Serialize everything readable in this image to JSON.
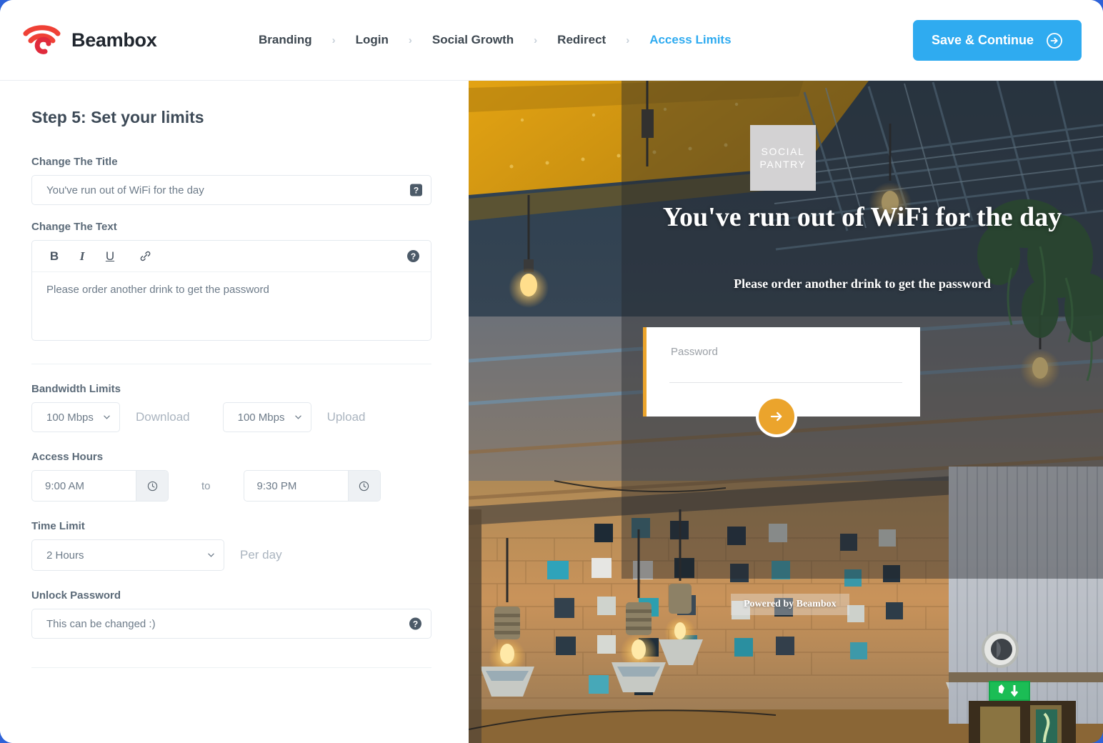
{
  "header": {
    "brand_name": "Beambox",
    "logo_icon": "beambox-wifi-logo",
    "breadcrumbs": [
      {
        "label": "Branding",
        "active": false
      },
      {
        "label": "Login",
        "active": false
      },
      {
        "label": "Social Growth",
        "active": false
      },
      {
        "label": "Redirect",
        "active": false
      },
      {
        "label": "Access Limits",
        "active": true
      }
    ],
    "separator": "›",
    "save_label": "Save & Continue",
    "save_icon": "arrow-right-circle-icon",
    "accent_color": "#2fabf0"
  },
  "form": {
    "step_title": "Step 5: Set your limits",
    "title_field": {
      "label": "Change The Title",
      "value": "You've run out of WiFi for the day",
      "help_icon": "help-badge-icon",
      "help_glyph": "?"
    },
    "text_field": {
      "label": "Change The Text",
      "value": "Please order another drink to get the password",
      "help_icon": "help-circle-icon",
      "help_glyph": "?",
      "toolbar": [
        {
          "name": "bold-button",
          "glyph": "B"
        },
        {
          "name": "italic-button",
          "glyph": "I"
        },
        {
          "name": "underline-button",
          "glyph": "U"
        },
        {
          "name": "link-button",
          "glyph": "🔗"
        }
      ]
    },
    "bandwidth": {
      "label": "Bandwidth Limits",
      "download": {
        "value": "100 Mbps",
        "unit_label": "Download"
      },
      "upload": {
        "value": "100 Mbps",
        "unit_label": "Upload"
      }
    },
    "access_hours": {
      "label": "Access Hours",
      "from": "9:00 AM",
      "to_label": "to",
      "until": "9:30 PM",
      "clock_icon": "clock-icon"
    },
    "time_limit": {
      "label": "Time Limit",
      "value": "2 Hours",
      "suffix": "Per day"
    },
    "unlock_password": {
      "label": "Unlock Password",
      "value": "This can be changed :)",
      "help_icon": "help-circle-icon",
      "help_glyph": "?"
    }
  },
  "preview": {
    "logo_line1": "SOCIAL",
    "logo_line2": "PANTRY",
    "hero_title": "You've run out of WiFi for the day",
    "hero_subtitle": "Please order another drink to get the password",
    "password_placeholder": "Password",
    "submit_icon": "arrow-right-icon",
    "footer": "Powered by Beambox",
    "accent_color": "#eba42c"
  }
}
